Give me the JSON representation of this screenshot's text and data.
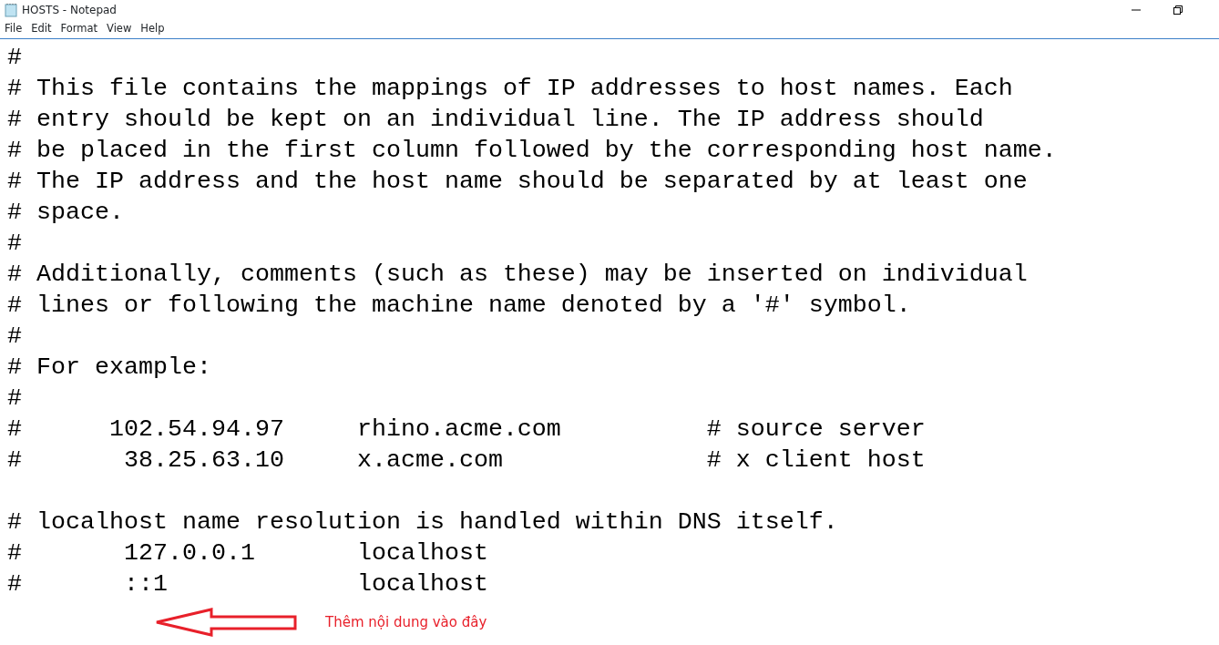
{
  "window": {
    "title": "HOSTS - Notepad"
  },
  "menu": [
    "File",
    "Edit",
    "Format",
    "View",
    "Help"
  ],
  "editor": {
    "blocks": [
      [
        "#",
        "# This file contains the mappings of IP addresses to host names. Each",
        "# entry should be kept on an individual line. The IP address should",
        "# be placed in the first column followed by the corresponding host name.",
        "# The IP address and the host name should be separated by at least one",
        "# space.",
        "#",
        "# Additionally, comments (such as these) may be inserted on individual",
        "# lines or following the machine name denoted by a '#' symbol.",
        "#",
        "# For example:",
        "#",
        "#      102.54.94.97     rhino.acme.com          # source server",
        "#       38.25.63.10     x.acme.com              # x client host"
      ],
      [
        "# localhost name resolution is handled within DNS itself.",
        "#       127.0.0.1       localhost",
        "#       ::1             localhost"
      ]
    ]
  },
  "annotation": {
    "text": "Thêm nội dung vào đây"
  }
}
